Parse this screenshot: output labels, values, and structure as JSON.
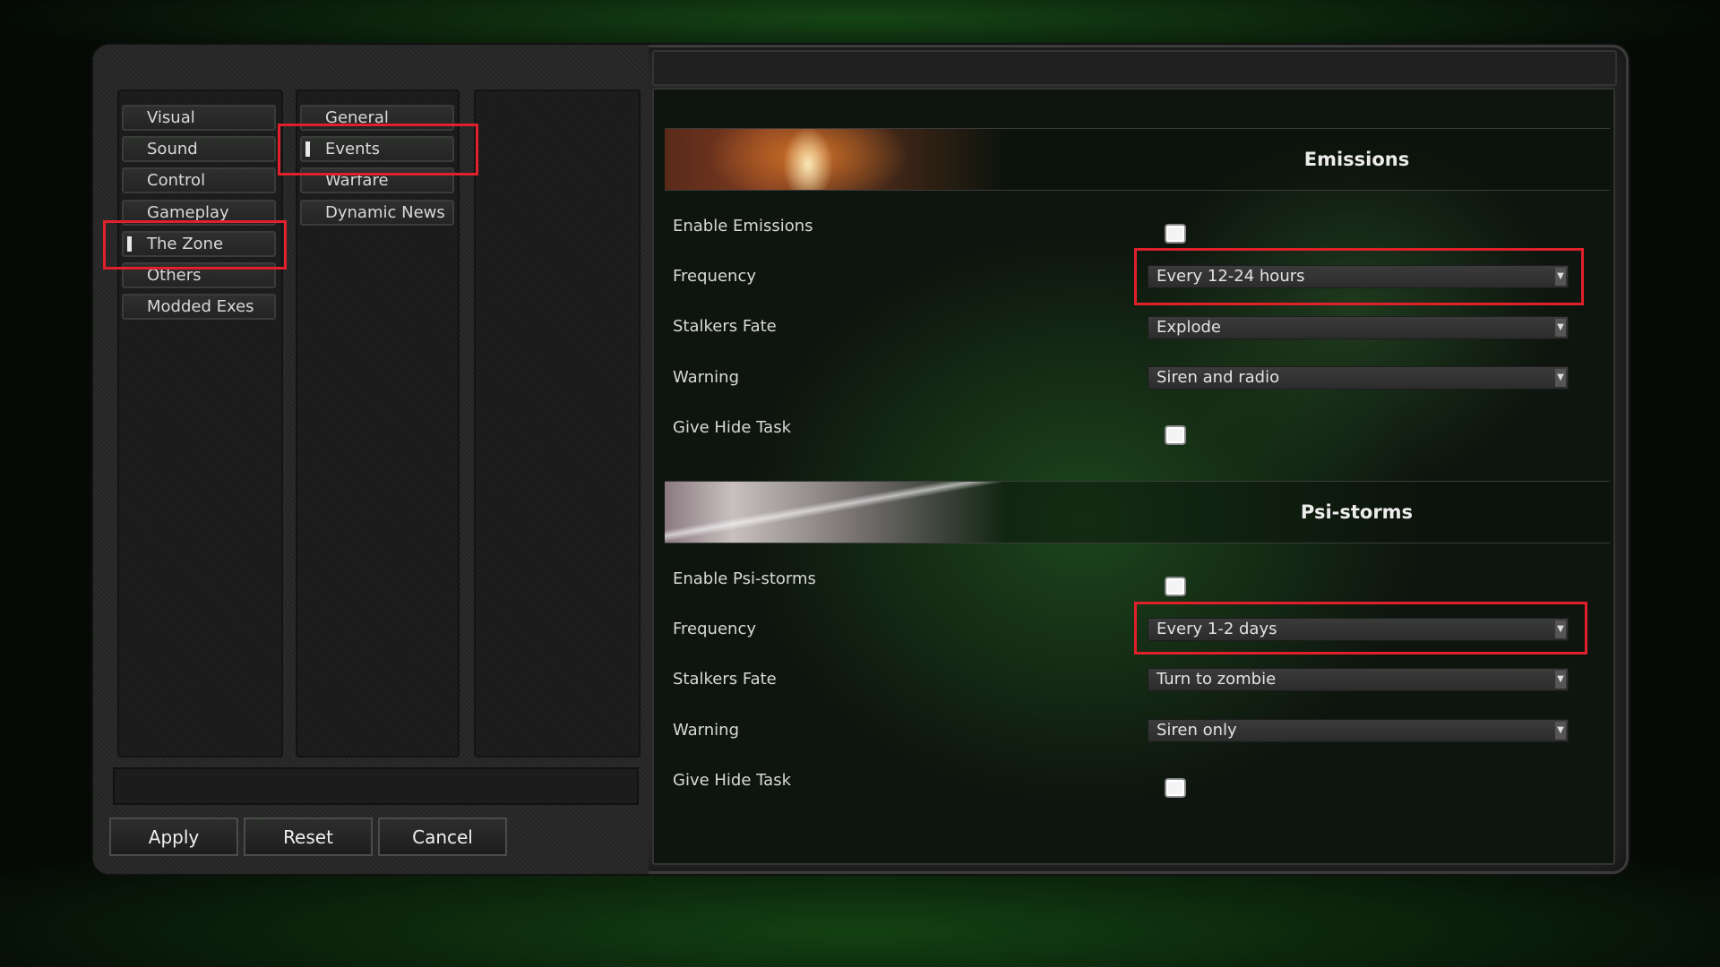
{
  "nav": {
    "categories": [
      "Visual",
      "Sound",
      "Control",
      "Gameplay",
      "The Zone",
      "Others",
      "Modded Exes"
    ],
    "selected_category": "The Zone",
    "subcategories": [
      "General",
      "Events",
      "Warfare",
      "Dynamic News"
    ],
    "selected_subcategory": "Events"
  },
  "buttons": {
    "apply": "Apply",
    "reset": "Reset",
    "cancel": "Cancel"
  },
  "emissions": {
    "title": "Emissions",
    "enable_label": "Enable Emissions",
    "frequency_label": "Frequency",
    "frequency_value": "Every 12-24 hours",
    "fate_label": "Stalkers Fate",
    "fate_value": "Explode",
    "warning_label": "Warning",
    "warning_value": "Siren and radio",
    "hide_label": "Give Hide Task"
  },
  "psi": {
    "title": "Psi-storms",
    "enable_label": "Enable Psi-storms",
    "frequency_label": "Frequency",
    "frequency_value": "Every 1-2 days",
    "fate_label": "Stalkers Fate",
    "fate_value": "Turn to zombie",
    "warning_label": "Warning",
    "warning_value": "Siren only",
    "hide_label": "Give Hide Task"
  },
  "colors": {
    "highlight": "#e0202a",
    "accent_green": "#1f6a1f"
  }
}
